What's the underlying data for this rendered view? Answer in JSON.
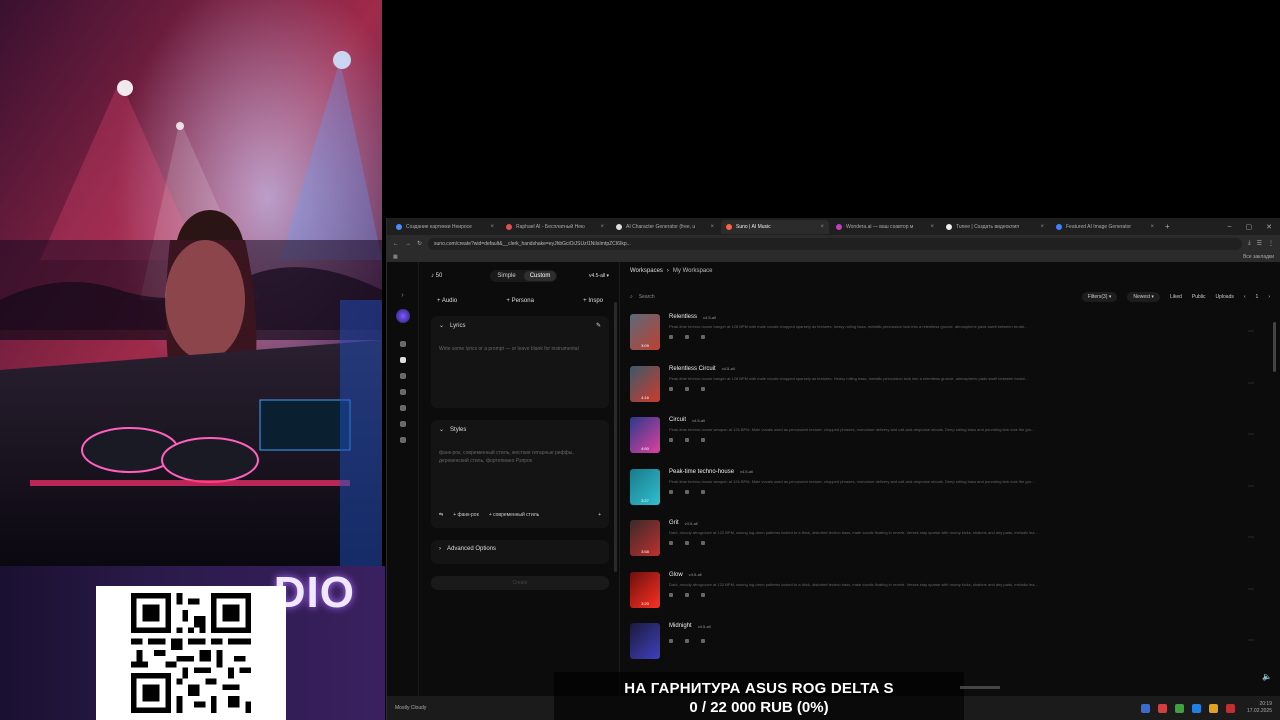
{
  "browser": {
    "tabs": [
      {
        "label": "Создание картинки Неиросе",
        "active": false
      },
      {
        "label": "Raphael AI - Бесплатный Нею",
        "active": false
      },
      {
        "label": "AI Character Generator (free, u",
        "active": false
      },
      {
        "label": "Suno | AI Music",
        "active": true
      },
      {
        "label": "Wondera.ai — ваш соавтор м",
        "active": false
      },
      {
        "label": "Tunee | Создать видеоклип",
        "active": false
      },
      {
        "label": "Featured AI Image Generator",
        "active": false
      }
    ],
    "url": "suno.com/create?wid=default&__clerk_handshake=eyJhbGciOiJSUzI1NiIsImtpZCI6Ikp...",
    "bookmarks_label": "Все закладки"
  },
  "create": {
    "credits": "50",
    "mode_simple": "Simple",
    "mode_custom": "Custom",
    "model": "v4.5-all",
    "add_audio": "Audio",
    "add_persona": "Persona",
    "add_inspo": "Inspo",
    "lyrics_title": "Lyrics",
    "lyrics_hint": "Write some lyrics or a prompt — or leave blank for instrumental",
    "styles_title": "Styles",
    "styles_hint": "фанк-рок, современный стиль, жесткие гитарные риффы, деревенский стиль, фортепиано Рэпрок",
    "style_tag_1": "фанк-рок",
    "style_tag_2": "современный стиль",
    "advanced_title": "Advanced Options",
    "create_label": "Create"
  },
  "workspace": {
    "crumb_root": "Workspaces",
    "crumb_current": "My Workspace",
    "search_placeholder": "Search",
    "filters": "Filters(3)",
    "sort": "Newest",
    "liked": "Liked",
    "public": "Public",
    "uploads": "Uploads",
    "page": "1",
    "songs": [
      {
        "title": "Relentless",
        "version": "v4.5-all",
        "duration": "3:09",
        "desc": "Peak-time techno-house banger at 128 BPM with male vocals chopped sparsely as textures, heavy rolling bass, metallic percussion lock into a relentless groove, atmospheric pads swell between brutal...",
        "colors": [
          "#5a6a7a",
          "#c04030"
        ]
      },
      {
        "title": "Relentless Circuit",
        "version": "v4.5-all",
        "duration": "4:16",
        "desc": "Peak-time techno-house banger at 128 BPM with male vocals chopped sparsely as textures. Heavy rolling bass, metallic percussion lock into a relentless groove, atmospheric pads swell between brutal...",
        "colors": [
          "#3a5a6a",
          "#d03a2a"
        ]
      },
      {
        "title": "Circuit",
        "version": "v4.5-all",
        "duration": "4:50",
        "desc": "Peak-time techno-house weapon at 126 BPM. Male vocals used as percussive texture: chopped phrases, monotone delivery and call-and-response shouts. Deep rolling bass and pounding kick lock the gro...",
        "colors": [
          "#2a3a8a",
          "#e040a0"
        ]
      },
      {
        "title": "Peak-time techno-house",
        "version": "v4.5-all",
        "duration": "3:27",
        "desc": "Peak-time techno-house weapon at 126 BPM. Male vocals used as percussive texture: chopped phrases, monotone delivery and call-and-response shouts. Deep rolling bass and pounding kick lock the gro...",
        "colors": [
          "#1a7a8a",
          "#30c0d0"
        ]
      },
      {
        "title": "Grit",
        "version": "v4.5-all",
        "duration": "3:58",
        "desc": "Dark, moody afrogroove at 122 BPM, swung log-drum patterns locked to a thick, distorted techno bass, male vocals floating in reverb. Verses stay sparse with roomy kicks, shakers and airy pads, melodic lea...",
        "colors": [
          "#3a2a2a",
          "#c03030"
        ]
      },
      {
        "title": "Glow",
        "version": "v4.5-all",
        "duration": "3:20",
        "desc": "Dark, moody afrogroove at 122 BPM, swung log-drum patterns locked to a thick, distorted techno bass, male vocals floating in reverb. Verses stay sparse with roomy kicks, shakers and airy pads, melodic lea...",
        "colors": [
          "#6a1010",
          "#ff3020"
        ]
      },
      {
        "title": "Midnight",
        "version": "v4.5-all",
        "duration": "",
        "desc": "",
        "colors": [
          "#1a1a3a",
          "#4040c0"
        ]
      }
    ]
  },
  "promo": {
    "studio_text": "DIO"
  },
  "donation": {
    "line1": "НА ГАРНИТУРА ASUS ROG DELTA S",
    "line2": "0 / 22 000 RUB (0%)",
    "progress": 0
  },
  "taskbar": {
    "weather": "Mostly Cloudy",
    "time": "20:19",
    "date": "17.02.2025"
  }
}
